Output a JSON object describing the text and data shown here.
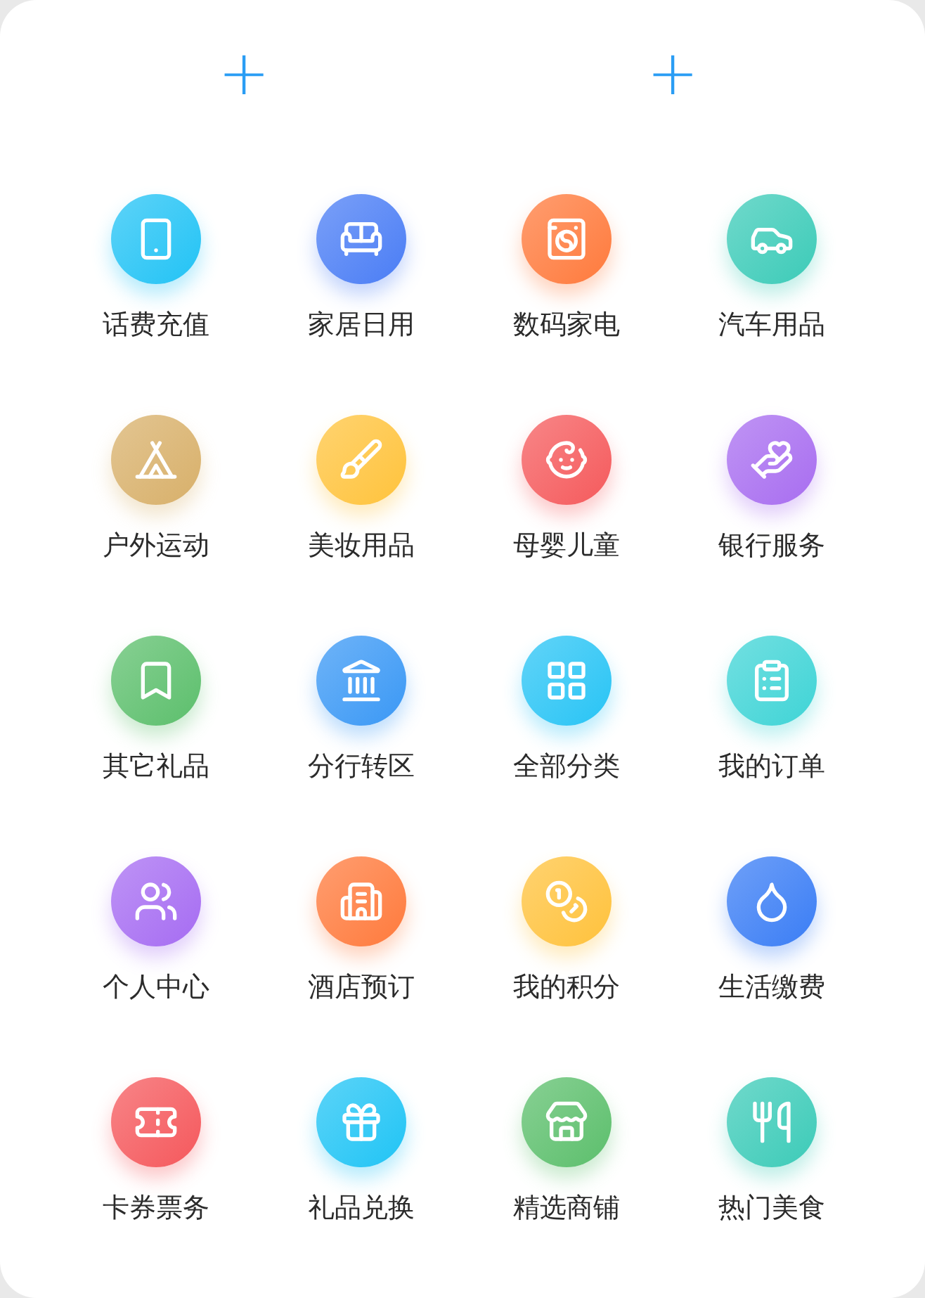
{
  "add_buttons": [
    "+",
    "+"
  ],
  "services": [
    {
      "label": "话费充值",
      "color": "#22c3f5"
    },
    {
      "label": "家居日用",
      "color": "#4a7df5"
    },
    {
      "label": "数码家电",
      "color": "#ff7a3c"
    },
    {
      "label": "汽车用品",
      "color": "#3ccbb8"
    },
    {
      "label": "户外运动",
      "color": "#d8b06a"
    },
    {
      "label": "美妆用品",
      "color": "#ffc33c"
    },
    {
      "label": "母婴儿童",
      "color": "#f55a5c"
    },
    {
      "label": "银行服务",
      "color": "#a86df0"
    },
    {
      "label": "其它礼品",
      "color": "#5cbf6c"
    },
    {
      "label": "分行转区",
      "color": "#3a98f5"
    },
    {
      "label": "全部分类",
      "color": "#28c4f5"
    },
    {
      "label": "我的订单",
      "color": "#3fd4d6"
    },
    {
      "label": "个人中心",
      "color": "#a66cf2"
    },
    {
      "label": "酒店预订",
      "color": "#ff7a3c"
    },
    {
      "label": "我的积分",
      "color": "#ffc23c"
    },
    {
      "label": "生活缴费",
      "color": "#3a7df5"
    },
    {
      "label": "卡券票务",
      "color": "#f5585c"
    },
    {
      "label": "礼品兑换",
      "color": "#20c4f5"
    },
    {
      "label": "精选商铺",
      "color": "#5cbf6c"
    },
    {
      "label": "热门美食",
      "color": "#3ccbb8"
    }
  ]
}
